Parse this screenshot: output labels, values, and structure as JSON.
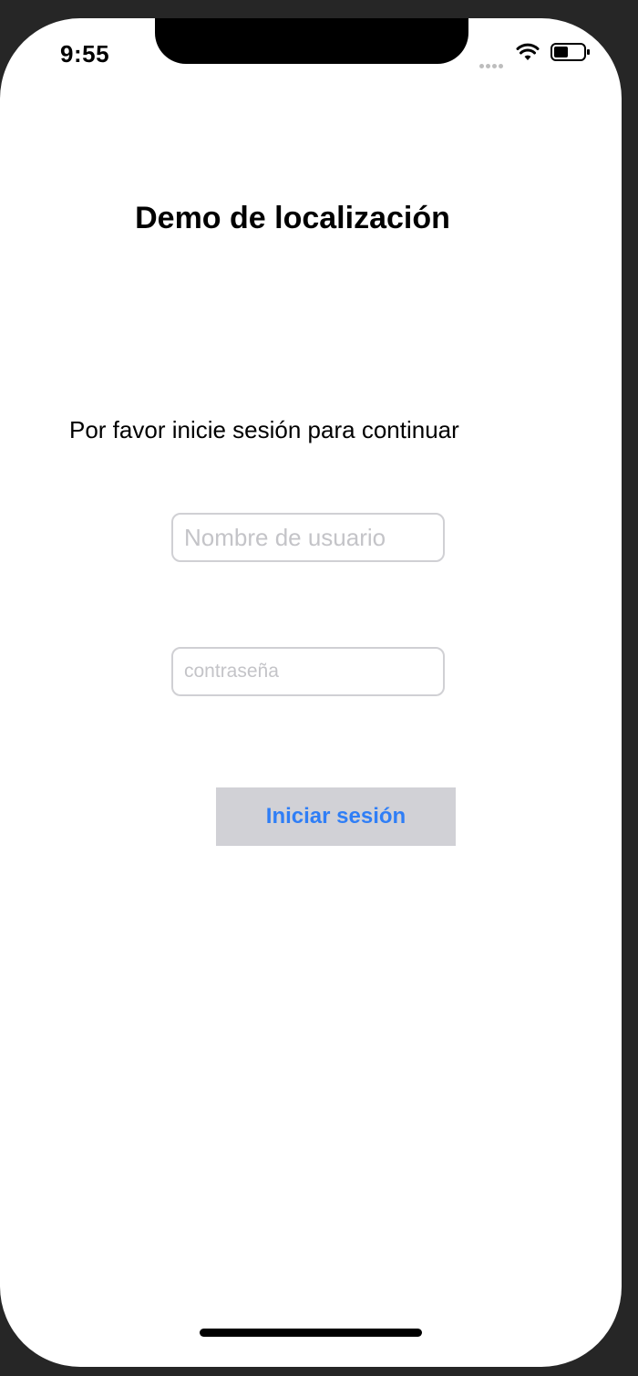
{
  "status_bar": {
    "time": "9:55",
    "icons": [
      "signal-dots-icon",
      "wifi-icon",
      "battery-icon"
    ]
  },
  "app": {
    "title": "Demo de localización",
    "subtitle": "Por favor inicie sesión para continuar",
    "username_field": {
      "value": "",
      "placeholder": "Nombre de usuario"
    },
    "password_field": {
      "value": "",
      "placeholder": "contraseña"
    },
    "login_button": {
      "label": "Iniciar sesión"
    }
  },
  "colors": {
    "accent": "#2f7ef6",
    "button_background": "#d1d1d6",
    "placeholder": "#c4c4c8",
    "field_border": "#d0d0d4"
  }
}
